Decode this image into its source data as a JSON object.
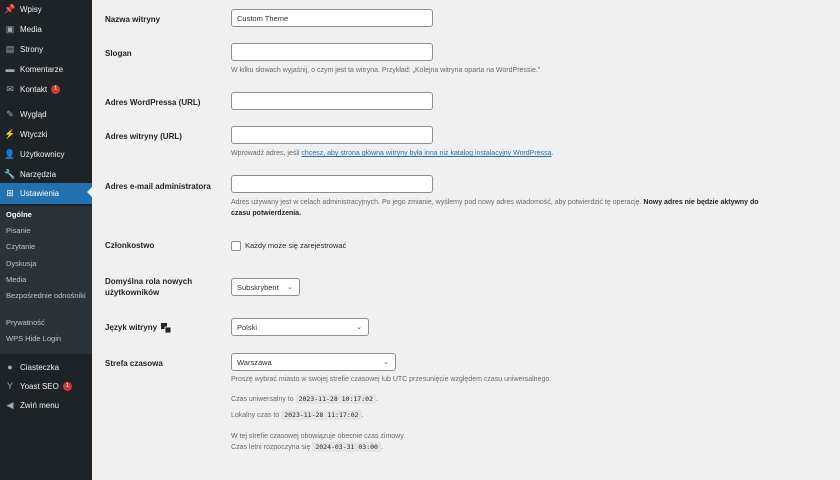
{
  "sidebar": {
    "items": [
      {
        "label": "Wpisy",
        "icon": "pin-icon"
      },
      {
        "label": "Media",
        "icon": "media-icon"
      },
      {
        "label": "Strony",
        "icon": "pages-icon"
      },
      {
        "label": "Komentarze",
        "icon": "comments-icon"
      },
      {
        "label": "Kontakt",
        "icon": "mail-icon",
        "badge": "1"
      },
      {
        "label": "Wygląd",
        "icon": "appearance-icon"
      },
      {
        "label": "Wtyczki",
        "icon": "plugins-icon"
      },
      {
        "label": "Użytkownicy",
        "icon": "users-icon"
      },
      {
        "label": "Narzędzia",
        "icon": "tools-icon"
      },
      {
        "label": "Ustawienia",
        "icon": "settings-icon"
      },
      {
        "label": "Ciasteczka",
        "icon": "cookie-icon"
      },
      {
        "label": "Yoast SEO",
        "icon": "yoast-icon",
        "badge": "1"
      },
      {
        "label": "Zwiń menu",
        "icon": "collapse-icon"
      }
    ],
    "submenu": [
      "Ogólne",
      "Pisanie",
      "Czytanie",
      "Dyskusja",
      "Media",
      "Bezpośrednie odnośniki",
      "Prywatność",
      "WPS Hide Login"
    ]
  },
  "form": {
    "site_title": {
      "label": "Nazwa witryny",
      "value": "Custom Theme"
    },
    "tagline": {
      "label": "Slogan",
      "value": "",
      "desc": "W kilku słowach wyjaśnij, o czym jest ta witryna. Przykład: „Kolejna witryna oparta na WordPressie.”"
    },
    "wp_address": {
      "label": "Adres WordPressa (URL)",
      "value": ""
    },
    "site_address": {
      "label": "Adres witryny (URL)",
      "value": "",
      "desc_prefix": "Wprowadź adres, jeśli ",
      "desc_link": "chcesz, aby strona główna witryny była inna niż katalog instalacyjny WordPressa",
      "desc_suffix": "."
    },
    "admin_email": {
      "label": "Adres e-mail administratora",
      "value": "",
      "desc_line1": "Adres używany jest w celach administracyjnych. Po jego zmianie, wyślemy pod nowy adres wiadomość, aby potwierdzić tę operację.",
      "desc_bold1": "Nowy adres nie będzie aktywny do",
      "desc_bold2": "czasu potwierdzenia."
    },
    "membership": {
      "label": "Członkostwo",
      "checkbox_label": "Każdy może się zarejestrować"
    },
    "default_role": {
      "label_line1": "Domyślna rola nowych",
      "label_line2": "użytkowników",
      "value": "Subskrybent"
    },
    "language": {
      "label": "Język witryny",
      "value": "Polski"
    },
    "timezone": {
      "label": "Strefa czasowa",
      "value": "Warszawa",
      "desc": "Proszę wybrać miasto w swojej strefie czasowej lub UTC przesunięcie względem czasu uniwersalnego.",
      "utc_label": "Czas uniwersalny to",
      "utc_value": "2023-11-28 10:17:02",
      "local_label": "Lokalny czas to",
      "local_value": "2023-11-28 11:17:02",
      "dst_line1": "W tej strefie czasowej obowiązuje obecnie czas zimowy.",
      "dst_label": "Czas letni rozpoczyna się",
      "dst_value": "2024-03-31 03:00",
      "period": "."
    }
  }
}
